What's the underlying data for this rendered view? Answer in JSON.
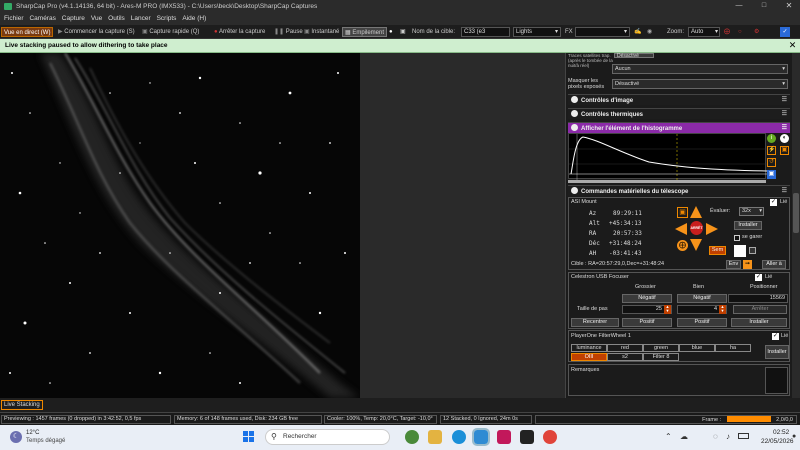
{
  "window": {
    "title": "SharpCap Pro (v4.1.14136, 64 bit) - Ares-M PRO (IMX533) - C:\\Users\\beck\\Desktop\\SharpCap Captures"
  },
  "menu": [
    "Fichier",
    "Caméras",
    "Capture",
    "Vue",
    "Outils",
    "Lancer",
    "Scripts",
    "Aide (H)"
  ],
  "toolbar": {
    "live": "Vue en direct (W)",
    "start": "Commencer la capture (S)",
    "quick": "Capture rapide (Q)",
    "stop": "Arrêter la capture",
    "pause": "Pause",
    "snapshot": "Instantané",
    "stack": "Empilement",
    "target_label": "Nom de la cible:",
    "target_value": "C33 (e3",
    "frame_type": "Lights",
    "fx_label": "FX",
    "zoom_label": "Zoom:",
    "zoom_value": "Auto"
  },
  "banner": "Live stacking paused to allow dithering to take place",
  "right_panel": {
    "partial": {
      "label1": "Traces satellites trap.(après le tombée de la nuit/à réel)",
      "value1": "Aucun",
      "label2": "Masquer les pixels exposés",
      "value2": "Désactivé",
      "badge": "Désactivé"
    },
    "sections": {
      "image": "Contrôles d'image",
      "thermal": "Contrôles thermiques",
      "histogram": "Afficher l'élément de l'histogramme",
      "hardware": "Commandes matérielles du télescope"
    },
    "mount": {
      "name": "ASI Mount",
      "connected": "Lié",
      "az_label": "Az",
      "az": "89:29:11",
      "alt_label": "Alt",
      "alt": "+45:34:13",
      "ra_label": "RA",
      "ra": "20:57:33",
      "dec_label": "Déc",
      "dec": "+31:48:24",
      "ah_label": "AH",
      "ah": "-03:41:43",
      "rate_label": "Évaluer:",
      "rate": "32x",
      "install": "Installer",
      "sync": "se garer",
      "park": "Sem",
      "center": "ARRÊT",
      "target": "Cible : RA=20:57:29,0,Dec=+31:48:24",
      "en": "Env",
      "goto": "Aller à"
    },
    "focuser": {
      "name": "Celestron USB Focuser",
      "connected": "Lié",
      "col1": "Grossier",
      "col2": "Bien",
      "col3": "Positionner",
      "neg": "Négatif",
      "neg2": "Négatif",
      "pos_value": "15569",
      "step_label": "Taille de pas",
      "step1": "25",
      "step2": "4",
      "stop": "Arrêter",
      "recentre": "Recentrer",
      "pos": "Positif",
      "pos2": "Positif",
      "install": "Installer"
    },
    "filterwheel": {
      "name": "PlayerOne FilterWheel 1",
      "connected": "Lié",
      "filters": [
        "luminance",
        "red",
        "green",
        "blue",
        "ha",
        "OIII",
        "s2",
        "Filter 8"
      ],
      "install": "Installer"
    },
    "remarks": "Remarques"
  },
  "live_stacking": "Live Stacking",
  "status": {
    "preview": "Previewing : 1457 frames (0 dropped) in 3:42:52, 0,5 fps",
    "memory": "Memory: 6 of 148 frames used, Disk: 234 GB free",
    "cooler": "Cooler: 100%, Temp: 20,0°C, Target: -10,0°",
    "stack": "12 Stacked, 0 Ignored, 24m 0s",
    "frame_label": "Frame :",
    "frame_value": "2,0/0,0"
  },
  "taskbar": {
    "temp": "12°C",
    "weather": "Temps dégagé",
    "search": "Rechercher",
    "time": "02:52",
    "date": "22/05/2026"
  },
  "colors": {
    "accent": "#8b2aa8",
    "orange": "#ff8c00",
    "banner": "#cfeecf"
  }
}
